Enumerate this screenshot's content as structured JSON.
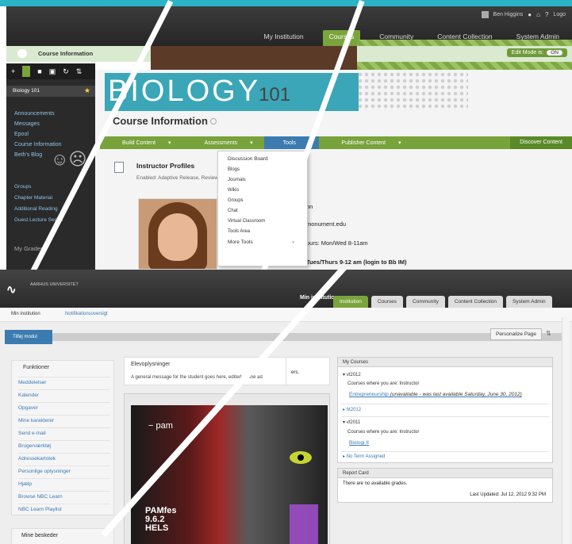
{
  "top": {
    "user_name": "Ben Higgins",
    "logout": "Logo",
    "tabs": [
      "My Institution",
      "Courses",
      "Community",
      "Content Collection",
      "System Admin"
    ],
    "active_tab": "Courses",
    "crumb": "Course Information",
    "edit_mode_label": "Edit Mode is:",
    "edit_mode_value": "ON",
    "course_title": "Biology 101",
    "course_menu_1": [
      "Announcements",
      "Messages",
      "Epool",
      "Course Information",
      "Beth's Blog"
    ],
    "course_menu_2": [
      "Groups",
      "Chapter Material",
      "Additional Reading",
      "Guest Lecture Series"
    ],
    "my_grades": "My Grades",
    "banner_big": "BIOLOGY",
    "banner_small": "101",
    "page_heading": "Course Information",
    "action_bar": [
      "Build Content",
      "Assessments",
      "Tools",
      "Publisher Content"
    ],
    "action_bar_right": "Discover Content",
    "instructor_title": "Instructor Profiles",
    "instructor_sub": "Enabled: Adaptive Release, Review",
    "info_lines": [
      "on",
      "monument.edu",
      "ours: Mon/Wed 8-11am",
      "Tues/Thurs 9-12 am (login to Bb IM)"
    ],
    "tools_menu": [
      "Discussion Board",
      "Blogs",
      "Journals",
      "Wikis",
      "Groups",
      "Chat",
      "Virtual Classroom",
      "Tools Area",
      "More Tools"
    ]
  },
  "bottom": {
    "logo_name": "AARHUS UNIVERSITET",
    "mi_label": "Min institution",
    "tabs": [
      "Institution",
      "Courses",
      "Community",
      "Content Collection",
      "System Admin"
    ],
    "sub_a": "Min institution",
    "sub_b": "Notifikationsoversigt",
    "add_module": "Tilføj modul",
    "personalize": "Personalize Page",
    "func_heading": "Funktioner",
    "func_items": [
      "Meddelelser",
      "Kalender",
      "Opgaver",
      "Mine karakterer",
      "Send e-mail",
      "Brugerværktøj",
      "Adressekartotek",
      "Personlige oplysninger",
      "Hjælp",
      "Browse NBC Learn",
      "NBC Learn Playlist"
    ],
    "messages_heading": "Mine beskeder",
    "ann_heading": "Elevoplysninger",
    "ann_msg": "A general message for the student goes here, edited by the ad",
    "ann_right": "ers.",
    "poster_logo": "pam",
    "poster_text1": "PAMfes",
    "poster_text2": "9.6.2",
    "poster_text3": "HELS",
    "courses_heading": "My Courses",
    "terms": [
      {
        "name": "vt2012",
        "role": "Courses where you are: Instructor",
        "course": "Entrepreneurship",
        "note": "(unavailable - was last available Saturday, June 30, 2012)"
      },
      {
        "name": "ht2012"
      },
      {
        "name": "vt2011",
        "role": "Courses where you are: Instructor",
        "course": "Biologi II"
      }
    ],
    "no_term": "No Term Assigned",
    "report_heading": "Report Card",
    "report_msg": "There are no available grades.",
    "report_updated": "Last Updated: Jul 12, 2012 9:32 PM"
  },
  "colors": {
    "accent_green": "#7aa43c",
    "accent_blue": "#3c7bb0",
    "teal": "#2bb3c8"
  }
}
